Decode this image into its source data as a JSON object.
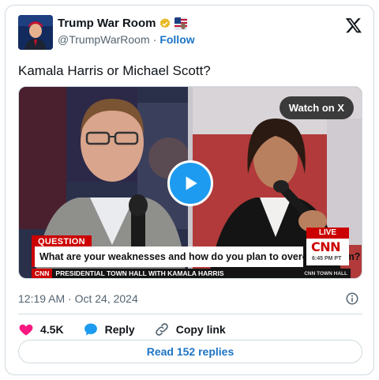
{
  "author": {
    "display_name": "Trump War Room",
    "handle": "@TrumpWarRoom",
    "separator": "·",
    "follow_label": "Follow"
  },
  "tweet": {
    "text": "Kamala Harris or Michael Scott?",
    "timestamp": "12:19 AM · Oct 24, 2024"
  },
  "media": {
    "watch_label": "Watch on X",
    "question_tag": "QUESTION",
    "question_text": "What are your weaknesses and how do you plan to overcome them?",
    "live_tag": "LIVE",
    "network_logo": "CNN",
    "clock": "6:45 PM PT",
    "ticker_network": "CNN",
    "ticker_text": "PRESIDENTIAL TOWN HALL WITH KAMALA HARRIS",
    "ticker_right": "CNN TOWN HALL"
  },
  "actions": {
    "likes": "4.5K",
    "reply_label": "Reply",
    "copy_label": "Copy link"
  },
  "replies_button": "Read 152 replies",
  "colors": {
    "brand_blue": "#1d9bf0",
    "link_blue": "#1d74c5",
    "like_pink": "#f91880",
    "cnn_red": "#cc0000",
    "verified_gold": "#e8b923"
  },
  "icons": [
    "x-logo-icon",
    "verified-badge-icon",
    "play-icon",
    "info-icon",
    "heart-icon",
    "reply-bubble-icon",
    "link-icon"
  ]
}
